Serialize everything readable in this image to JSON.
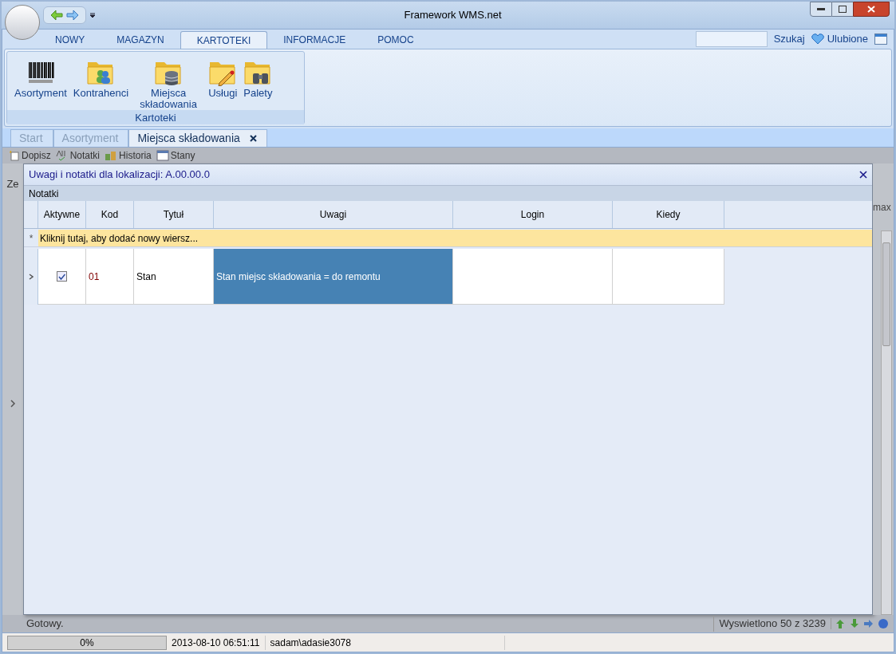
{
  "window": {
    "title": "Framework WMS.net"
  },
  "ribbon_tabs": [
    {
      "label": "NOWY",
      "selected": false
    },
    {
      "label": "MAGAZYN",
      "selected": false
    },
    {
      "label": "KARTOTEKI",
      "selected": true
    },
    {
      "label": "INFORMACJE",
      "selected": false
    },
    {
      "label": "POMOC",
      "selected": false
    }
  ],
  "search": {
    "button": "Szukaj"
  },
  "favorites": {
    "label": "Ulubione"
  },
  "ribbon_group": {
    "title": "Kartoteki",
    "buttons": [
      {
        "label": "Asortyment",
        "kind": "barcode"
      },
      {
        "label": "Kontrahenci",
        "kind": "people"
      },
      {
        "label": "Miejsca składowania",
        "kind": "database"
      },
      {
        "label": "Usługi",
        "kind": "pencil"
      },
      {
        "label": "Palety",
        "kind": "binoculars"
      }
    ]
  },
  "document_tabs": [
    {
      "label": "Start",
      "selected": false
    },
    {
      "label": "Asortyment",
      "selected": false
    },
    {
      "label": "Miejsca składowania",
      "selected": true
    }
  ],
  "toolbar": [
    {
      "label": "Dopisz",
      "kind": "new"
    },
    {
      "label": "Notatki",
      "kind": "spell"
    },
    {
      "label": "Historia",
      "kind": "history"
    },
    {
      "label": "Stany",
      "kind": "calendar"
    }
  ],
  "background_grid": {
    "left_text": "Ze",
    "right_text": "max",
    "status_left": "Gotowy.",
    "status_right": "Wyswietlono 50 z 3239"
  },
  "dialog": {
    "title": "Uwagi i notatki dla lokalizacji: A.00.00.0",
    "section": "Notatki",
    "columns": [
      "Aktywne",
      "Kod",
      "Tytuł",
      "Uwagi",
      "Login",
      "Kiedy"
    ],
    "new_row": {
      "marker": "*",
      "text": "Kliknij tutaj, aby dodać nowy wiersz..."
    },
    "rows": [
      {
        "current": true,
        "cells": [
          {
            "kind": "checkbox",
            "checked": true,
            "selected": false
          },
          {
            "kind": "code",
            "text": "01",
            "selected": false
          },
          {
            "kind": "text",
            "text": "Stan",
            "selected": false
          },
          {
            "kind": "text",
            "text": "Stan miejsc składowania = do remontu",
            "selected": true
          },
          {
            "kind": "text",
            "selected": false
          },
          {
            "kind": "text",
            "selected": false
          }
        ]
      }
    ]
  },
  "status_bar": {
    "progress": {
      "level": 0,
      "text": "0%"
    },
    "time": "2013-08-10 06:51:11",
    "user": "sadam\\adasie3078"
  }
}
